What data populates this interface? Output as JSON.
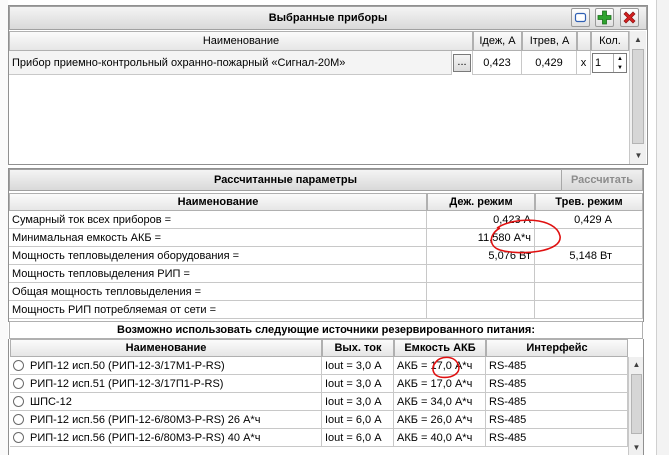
{
  "selected": {
    "title": "Выбранные приборы",
    "columns": {
      "name": "Наименование",
      "idle": "Iдеж, А",
      "alarm": "Iтрев, А",
      "qty": "Кол."
    },
    "row": {
      "name": "Прибор приемно-контрольный охранно-пожарный «Сигнал-20М»",
      "browse": "...",
      "idle": "0,423",
      "alarm": "0,429",
      "times": "x",
      "qty": "1"
    },
    "icons": [
      "copy-icon",
      "add-icon",
      "delete-icon"
    ]
  },
  "params": {
    "title": "Рассчитанные параметры",
    "calc_button": "Рассчитать",
    "columns": {
      "name": "Наименование",
      "idle": "Деж. режим",
      "alarm": "Трев. режим"
    },
    "rows": [
      {
        "name": "Сумарный ток всех приборов =",
        "idle": "0,423 А",
        "alarm": "0,429 А"
      },
      {
        "name": "Минимальная емкость АКБ =",
        "idle": "11,580 А*ч",
        "alarm": ""
      },
      {
        "name": "Мощность тепловыделения оборудования =",
        "idle": "5,076 Вт",
        "alarm": "5,148 Вт"
      },
      {
        "name": "Мощность тепловыделения РИП =",
        "idle": "",
        "alarm": ""
      },
      {
        "name": "Общая мощность тепловыделения =",
        "idle": "",
        "alarm": ""
      },
      {
        "name": "Мощность РИП потребляемая от сети =",
        "idle": "",
        "alarm": ""
      }
    ]
  },
  "sources": {
    "title": "Возможно использовать следующие источники резервированного питания:",
    "columns": {
      "name": "Наименование",
      "out": "Вых. ток",
      "cap": "Емкость АКБ",
      "iface": "Интерфейс"
    },
    "rows": [
      {
        "name": "РИП-12 исп.50 (РИП-12-3/17М1-Р-RS)",
        "out": "Iout = 3,0 А",
        "cap": "АКБ = 17,0 А*ч",
        "iface": "RS-485"
      },
      {
        "name": "РИП-12 исп.51 (РИП-12-3/17П1-Р-RS)",
        "out": "Iout = 3,0 А",
        "cap": "АКБ = 17,0 А*ч",
        "iface": "RS-485"
      },
      {
        "name": "ШПС-12",
        "out": "Iout = 3,0 А",
        "cap": "АКБ = 34,0 А*ч",
        "iface": "RS-485"
      },
      {
        "name": "РИП-12 исп.56 (РИП-12-6/80М3-Р-RS) 26 А*ч",
        "out": "Iout = 6,0 А",
        "cap": "АКБ = 26,0 А*ч",
        "iface": "RS-485"
      },
      {
        "name": "РИП-12 исп.56 (РИП-12-6/80М3-Р-RS) 40 А*ч",
        "out": "Iout = 6,0 А",
        "cap": "АКБ = 40,0 А*ч",
        "iface": "RS-485"
      }
    ]
  },
  "annotation_color": "#e01010"
}
